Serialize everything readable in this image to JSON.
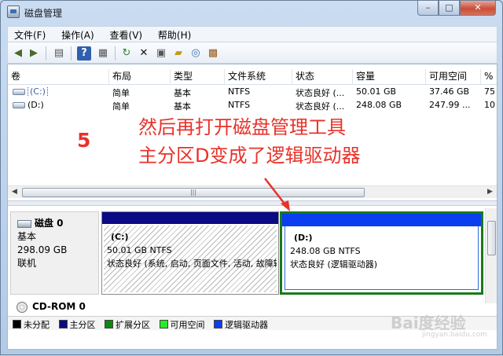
{
  "window": {
    "title": "磁盘管理",
    "minimize": "–",
    "maximize": "□",
    "close": "✕"
  },
  "menu": [
    "文件(F)",
    "操作(A)",
    "查看(V)",
    "帮助(H)"
  ],
  "toolbar_icons": [
    "back-icon",
    "forward-icon",
    "console-icon",
    "help-icon",
    "properties-icon",
    "refresh-icon",
    "delete-icon",
    "properties2-icon",
    "open-icon",
    "find-icon",
    "export-icon"
  ],
  "volume_table": {
    "columns": [
      "卷",
      "布局",
      "类型",
      "文件系统",
      "状态",
      "容量",
      "可用空间",
      "%"
    ],
    "rows": [
      {
        "vol": "(C:)",
        "layout": "简单",
        "type": "基本",
        "fs": "NTFS",
        "status": "状态良好 (...",
        "capacity": "50.01 GB",
        "free": "37.46 GB",
        "pct": "75"
      },
      {
        "vol": "(D:)",
        "layout": "简单",
        "type": "基本",
        "fs": "NTFS",
        "status": "状态良好 (...",
        "capacity": "248.08 GB",
        "free": "247.99 ...",
        "pct": "10"
      }
    ]
  },
  "annotation": {
    "step": "5",
    "line1": "然后再打开磁盘管理工具",
    "line2": "主分区D变成了逻辑驱动器",
    "color": "#e8322a"
  },
  "scroll": {
    "left": "◀",
    "right": "▶",
    "grip": "|||"
  },
  "disk0": {
    "title": "磁盘 0",
    "kind": "基本",
    "size": "298.09 GB",
    "state": "联机",
    "partitions": [
      {
        "name": "(C:)",
        "size": "50.01 GB NTFS",
        "status": "状态良好 (系统, 启动, 页面文件, 活动, 故障转储, 主分区)"
      },
      {
        "name": "(D:)",
        "size": "248.08 GB NTFS",
        "status": "状态良好 (逻辑驱动器)"
      }
    ]
  },
  "cdrom": {
    "title": "CD-ROM 0"
  },
  "legend": [
    {
      "label": "未分配",
      "color": "#000000"
    },
    {
      "label": "主分区",
      "color": "#0a0a84"
    },
    {
      "label": "扩展分区",
      "color": "#0a8a0a"
    },
    {
      "label": "可用空间",
      "color": "#22ee22"
    },
    {
      "label": "逻辑驱动器",
      "color": "#0a3ef0"
    }
  ],
  "watermark": {
    "text": "Bai度经验",
    "sub": "jingyan.baidu.com"
  }
}
